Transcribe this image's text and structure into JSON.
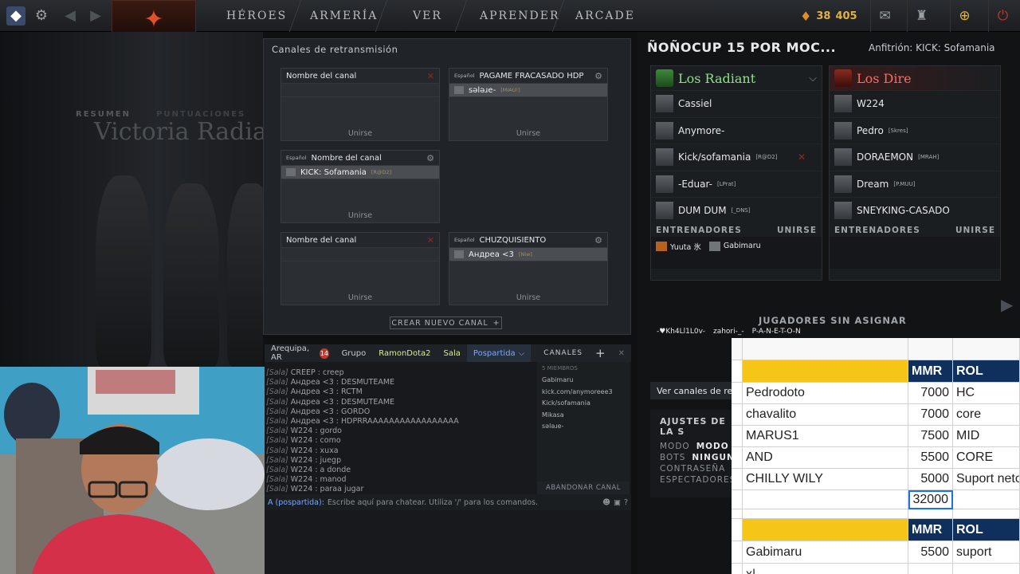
{
  "nav": {
    "links": [
      "HÉROES",
      "ARMERÍA",
      "VER",
      "APRENDER",
      "ARCADE"
    ],
    "currency": {
      "shards_a": "38",
      "shards_b": "405"
    }
  },
  "background": {
    "summary_tabs": [
      "RESUMEN",
      "PUNTUACIONES"
    ],
    "victory_text": "Victoria Radiant"
  },
  "broadcast": {
    "title": "Canales de retransmisión",
    "join_label": "Unirse",
    "new_channel_label": "CREAR NUEVO CANAL",
    "channels": [
      {
        "lang": "",
        "name": "Nombre del canal",
        "occupant": "",
        "occupant_tag": ""
      },
      {
        "lang": "Español",
        "name": "PAGAME FRACASADO HDP",
        "occupant": "sәlәɹe-",
        "occupant_tag": "[MIAU!]"
      },
      {
        "lang": "Español",
        "name": "Nombre del canal",
        "occupant": "KICK: Sofamania",
        "occupant_tag": "[R@D2]"
      },
      {
        "lang": "",
        "name": "Nombre del canal",
        "occupant": "",
        "occupant_tag": ""
      },
      {
        "lang": "Español",
        "name": "CHUZQUISIENTO",
        "occupant": "Андреа <3",
        "occupant_tag": "[Niw]"
      }
    ]
  },
  "chat": {
    "tabs": [
      "Arequipa, AR",
      "Grupo",
      "RamonDota2",
      "Sala",
      "Pospartida"
    ],
    "tab_badge": "14",
    "messages": [
      {
        "channel": "[Sala]",
        "user": "CREEP",
        "text": "creep"
      },
      {
        "channel": "[Sala]",
        "user": "Андреа <3",
        "text": "DESMUTEAME"
      },
      {
        "channel": "[Sala]",
        "user": "Андреа <3",
        "text": "RCTM"
      },
      {
        "channel": "[Sala]",
        "user": "Андреа <3",
        "text": "DESMUTEAME"
      },
      {
        "channel": "[Sala]",
        "user": "Андреа <3",
        "text": "GORDO"
      },
      {
        "channel": "[Sala]",
        "user": "Андреа <3",
        "text": "HDPRRAAAAAAAAAAAAAAAAA"
      },
      {
        "channel": "[Sala]",
        "user": "W224",
        "text": "gordo"
      },
      {
        "channel": "[Sala]",
        "user": "W224",
        "text": "como"
      },
      {
        "channel": "[Sala]",
        "user": "W224",
        "text": "xuxa"
      },
      {
        "channel": "[Sala]",
        "user": "W224",
        "text": "juegp"
      },
      {
        "channel": "[Sala]",
        "user": "W224",
        "text": "a donde"
      },
      {
        "channel": "[Sala]",
        "user": "W224",
        "text": "manod"
      },
      {
        "channel": "[Sala]",
        "user": "W224",
        "text": "paraa jugar"
      }
    ],
    "input_target": "A (pospartida):",
    "input_placeholder": "Escribe aquí para chatear. Utiliza '/' para los comandos.",
    "channels_label": "CANALES",
    "members_count": "5 MIEMBROS",
    "members": [
      "Gabimaru",
      "kick.com/anymoreee3",
      "Kick/sofamania",
      "Mikasa",
      "sәlәɹe-"
    ],
    "leave_label": "ABANDONAR CANAL"
  },
  "lobby": {
    "title": "ÑOÑOCUP 15 POR MOC...",
    "host": "Anfitrión: KICK: Sofamania",
    "radiant": {
      "name": "Los Radiant",
      "players": [
        {
          "name": "Cassiel",
          "tag": ""
        },
        {
          "name": "Anymore-",
          "tag": ""
        },
        {
          "name": "Kick/sofamania",
          "tag": "[R@D2]"
        },
        {
          "name": "-Eduar-",
          "tag": "[LPrat]"
        },
        {
          "name": "DUM DUM",
          "tag": "[_DNS]"
        }
      ],
      "coaches": [
        "Yuuta 氷",
        "Gabimaru"
      ]
    },
    "dire": {
      "name": "Los Dire",
      "players": [
        {
          "name": "W224",
          "tag": ""
        },
        {
          "name": "Pedro",
          "tag": "[Skres]"
        },
        {
          "name": "DORAEMON",
          "tag": "[MRAH]"
        },
        {
          "name": "Dream",
          "tag": "[P.MUU]"
        },
        {
          "name": "SNEYKING-CASADO",
          "tag": ""
        }
      ],
      "coaches": []
    },
    "coaches_label": "ENTRENADORES",
    "join_label": "UNIRSE",
    "unassigned_label": "JUGADORES SIN ASIGNAR",
    "unassigned": [
      "-♥Kh4Ll1L0v-",
      "zahori-_-",
      "P-A-N-E-T-O-N"
    ],
    "view_channels": "Ver canales de re",
    "settings_title": "AJUSTES DE LA S",
    "settings": [
      {
        "label": "MODO",
        "value": "MODO"
      },
      {
        "label": "BOTS",
        "value": "NINGUNO"
      },
      {
        "label": "CONTRASEÑA",
        "value": ""
      },
      {
        "label": "ESPECTADORES",
        "value": ""
      }
    ]
  },
  "sheet": {
    "header": [
      "",
      "MMR",
      "ROL"
    ],
    "rows": [
      [
        "Pedrodoto",
        "7000",
        "HC"
      ],
      [
        "chavalito",
        "7000",
        "core"
      ],
      [
        "MARUS1",
        "7500",
        "MID"
      ],
      [
        "AND",
        "5500",
        "CORE"
      ],
      [
        "CHILLY WILY",
        "5000",
        "Suport neto"
      ]
    ],
    "total": "32000",
    "header2": [
      "",
      "MMR",
      "ROL"
    ],
    "rows2": [
      [
        "Gabimaru",
        "5500",
        "suport"
      ],
      [
        "x|",
        "",
        ""
      ]
    ]
  }
}
